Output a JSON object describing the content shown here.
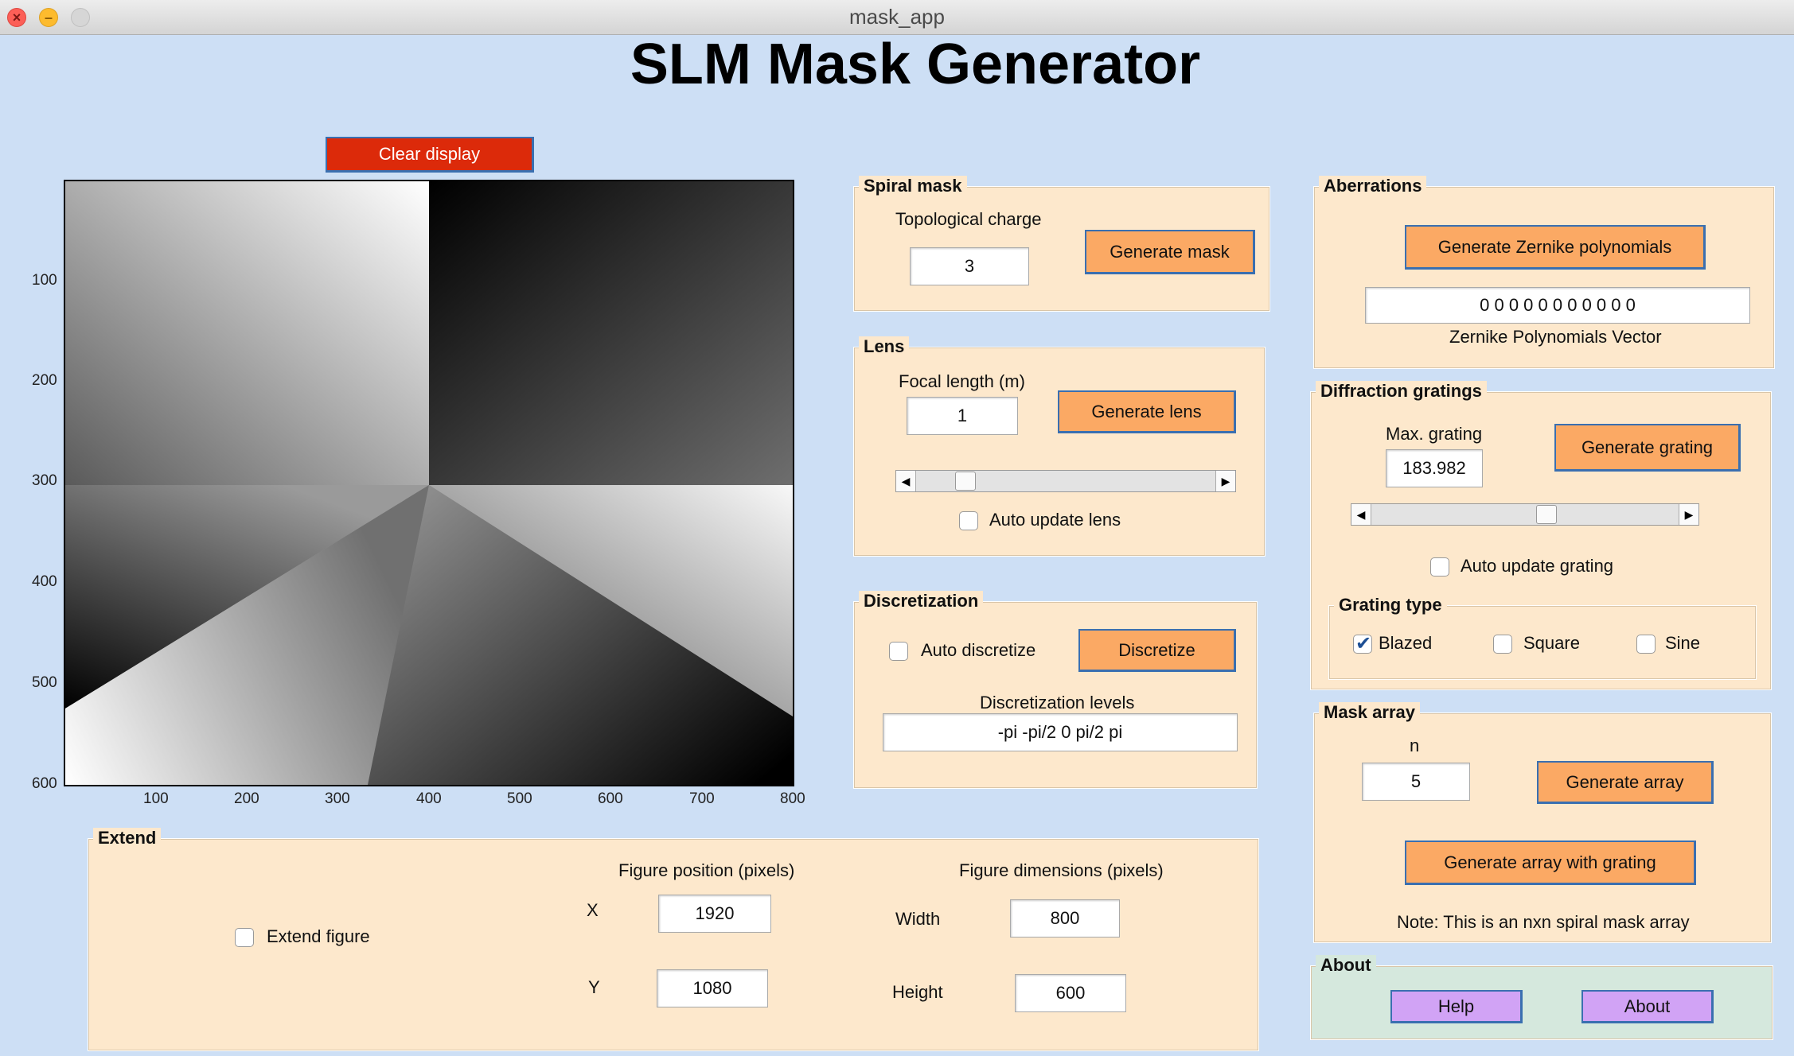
{
  "window": {
    "title": "mask_app"
  },
  "app_title": "SLM Mask Generator",
  "clear_button": "Clear display",
  "plot": {
    "y_ticks": [
      "100",
      "200",
      "300",
      "400",
      "500",
      "600"
    ],
    "x_ticks": [
      "100",
      "200",
      "300",
      "400",
      "500",
      "600",
      "700",
      "800"
    ]
  },
  "spiral": {
    "title": "Spiral mask",
    "charge_label": "Topological charge",
    "charge_value": "3",
    "generate_button": "Generate mask"
  },
  "lens": {
    "title": "Lens",
    "focal_label": "Focal length (m)",
    "focal_value": "1",
    "generate_button": "Generate lens",
    "auto_update_label": "Auto update lens",
    "auto_update_checked": false
  },
  "discretization": {
    "title": "Discretization",
    "auto_label": "Auto discretize",
    "auto_checked": false,
    "button": "Discretize",
    "levels_label": "Discretization levels",
    "levels_value": "-pi -pi/2 0 pi/2 pi"
  },
  "aberrations": {
    "title": "Aberrations",
    "generate_button": "Generate Zernike polynomials",
    "vector_value": "0 0 0 0 0 0 0 0 0 0 0",
    "vector_label": "Zernike Polynomials Vector"
  },
  "gratings": {
    "title": "Diffraction gratings",
    "max_label": "Max. grating",
    "max_value": "183.982",
    "generate_button": "Generate grating",
    "auto_update_label": "Auto update grating",
    "auto_update_checked": false,
    "type_title": "Grating type",
    "types": [
      {
        "label": "Blazed",
        "checked": true
      },
      {
        "label": "Square",
        "checked": false
      },
      {
        "label": "Sine",
        "checked": false
      }
    ]
  },
  "mask_array": {
    "title": "Mask array",
    "n_label": "n",
    "n_value": "5",
    "generate_button": "Generate array",
    "generate_with_grating_button": "Generate array with grating",
    "note": "Note: This is an nxn spiral mask array"
  },
  "about": {
    "title": "About",
    "help_button": "Help",
    "about_button": "About"
  },
  "extend": {
    "title": "Extend",
    "checkbox_label": "Extend figure",
    "checked": false,
    "position_label": "Figure position (pixels)",
    "x_label": "X",
    "x_value": "1920",
    "y_label": "Y",
    "y_value": "1080",
    "dimensions_label": "Figure dimensions (pixels)",
    "width_label": "Width",
    "width_value": "800",
    "height_label": "Height",
    "height_value": "600"
  }
}
